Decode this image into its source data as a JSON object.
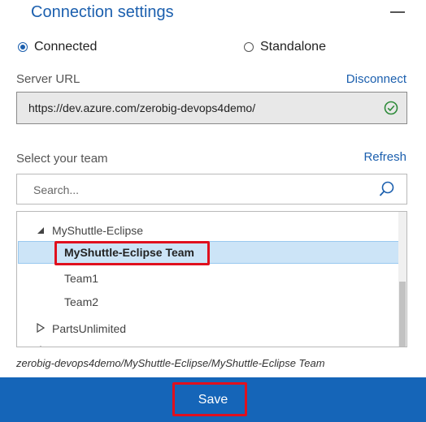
{
  "header": {
    "title": "Connection settings"
  },
  "connection": {
    "options": [
      {
        "label": "Connected",
        "selected": true
      },
      {
        "label": "Standalone",
        "selected": false
      }
    ]
  },
  "server": {
    "label": "Server URL",
    "disconnect_label": "Disconnect",
    "url": "https://dev.azure.com/zerobig-devops4demo/",
    "status_icon": "check-circle-icon",
    "status_color": "#2e8b3a"
  },
  "team": {
    "label": "Select your team",
    "refresh_label": "Refresh",
    "search_placeholder": "Search...",
    "tree": {
      "items": [
        {
          "label": "MyShuttle-Eclipse",
          "expanded": true
        },
        {
          "label": "MyShuttle-Eclipse Team",
          "selected": true
        },
        {
          "label": "Team1"
        },
        {
          "label": "Team2"
        },
        {
          "label": "PartsUnlimited",
          "expanded": false
        }
      ]
    },
    "selected_path": "zerobig-devops4demo/MyShuttle-Eclipse/MyShuttle-Eclipse Team"
  },
  "footer": {
    "save_label": "Save"
  },
  "colors": {
    "accent": "#1b5fae",
    "save_bar": "#1565b8",
    "highlight": "#e0101e"
  }
}
